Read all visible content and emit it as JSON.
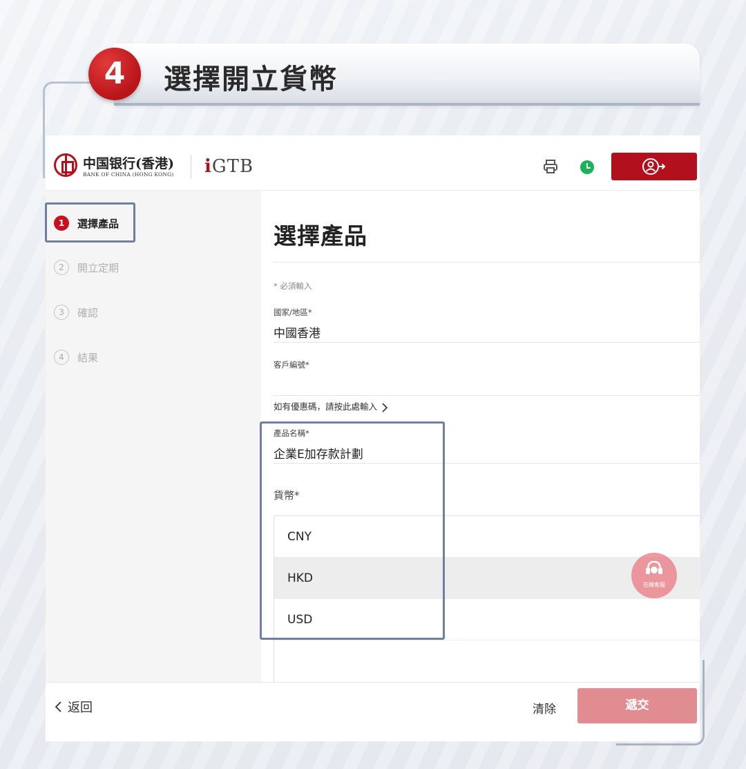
{
  "banner": {
    "step_number": "4",
    "title": "選擇開立貨幣"
  },
  "header": {
    "logo_cn": "中国银行(香港)",
    "logo_en": "BANK OF CHINA (HONG KONG)",
    "gtb_prefix": "i",
    "gtb_text": "GTB",
    "icons": [
      "printer-icon",
      "clock-icon",
      "logout-icon"
    ]
  },
  "sidebar": {
    "steps": [
      {
        "num": "1",
        "label": "選擇產品",
        "active": true
      },
      {
        "num": "2",
        "label": "開立定期",
        "active": false
      },
      {
        "num": "3",
        "label": "確認",
        "active": false
      },
      {
        "num": "4",
        "label": "結果",
        "active": false
      }
    ]
  },
  "form": {
    "title": "選擇產品",
    "required_note": "* 必須輸入",
    "country_label": "國家/地區*",
    "country_value": "中國香港",
    "customer_label": "客戶編號*",
    "customer_value": "",
    "promo_link": "如有優惠碼，請按此處輸入",
    "product_label": "產品名稱*",
    "product_value": "企業E加存款計劃",
    "currency_label": "貨幣*",
    "currency_options": [
      "CNY",
      "HKD",
      "USD"
    ],
    "hovered_option": "HKD"
  },
  "chat": {
    "label": "在線客服"
  },
  "footer": {
    "back_label": "返回",
    "clear_label": "清除",
    "submit_label": "遞交"
  },
  "colors": {
    "brand_red": "#b3101e",
    "submit_disabled": "#e08c91",
    "highlight_border": "#6e7fa0",
    "clock_green": "#19b35a"
  }
}
